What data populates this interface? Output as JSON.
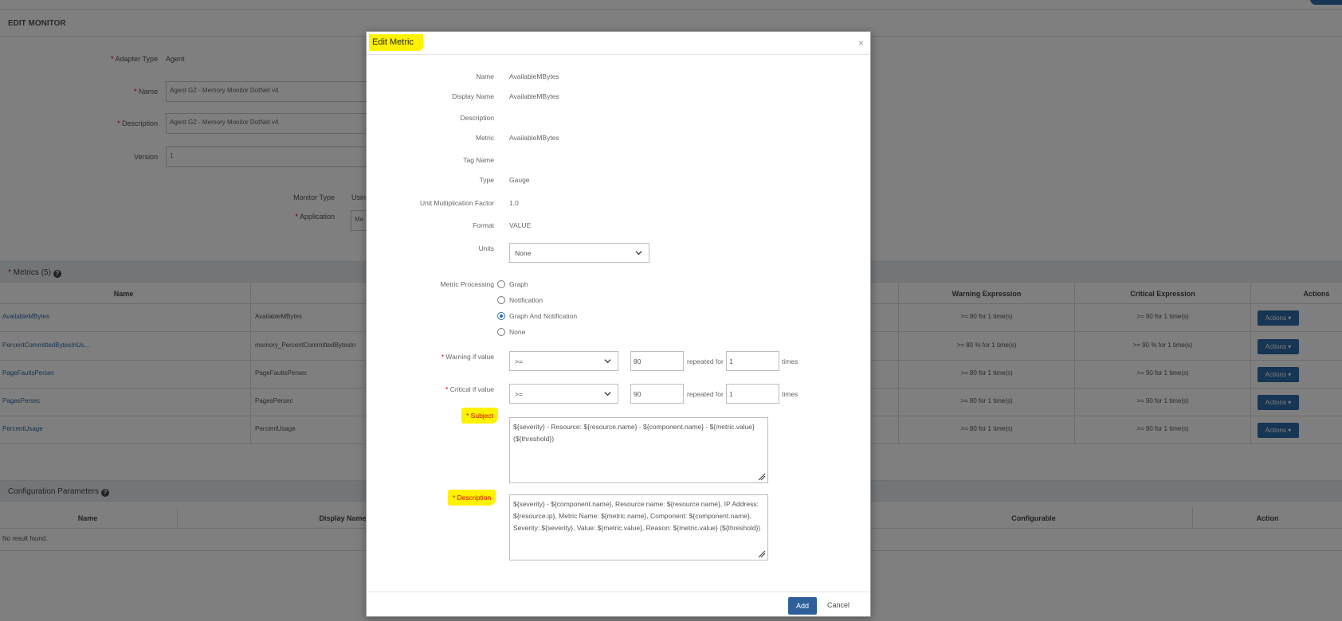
{
  "page": {
    "title": "EDIT MONITOR",
    "form": {
      "adapter_type_label": "Adapter Type",
      "adapter_type_value": "Agent",
      "name_label": "Name",
      "name_value": "Agent G2 - Memory Monitor DotNet v4",
      "description_label": "Description",
      "description_value": "Agent G2 - Memory Monitor DotNet v4",
      "version_label": "Version",
      "version_value": "1",
      "monitor_type_label": "Monitor Type",
      "monitor_type_value": "Usin",
      "application_label": "Application",
      "application_value": "Me"
    },
    "metrics": {
      "title": "Metrics (5)",
      "columns": [
        "Name",
        "Warning Expression",
        "Critical Expression",
        "Actions"
      ],
      "rows": [
        {
          "name": "AvailableMBytes",
          "display": "AvailableMBytes",
          "warning": ">= 80 for 1 time(s)",
          "critical": ">= 90 for 1 time(s)"
        },
        {
          "name": "PercentCommittedBytesInUs...",
          "display": "memory_PercentCommittedBytesIn",
          "warning": ">= 80 % for 1 time(s)",
          "critical": ">= 90 % for 1 time(s)"
        },
        {
          "name": "PageFaultsPersec",
          "display": "PageFaultsPersec",
          "warning": ">= 80 for 1 time(s)",
          "critical": ">= 90 for 1 time(s)"
        },
        {
          "name": "PagesPersec",
          "display": "PagesPersec",
          "warning": ">= 80 for 1 time(s)",
          "critical": ">= 90 for 1 time(s)"
        },
        {
          "name": "PercentUsage",
          "display": "PercentUsage",
          "warning": ">= 80 for 1 time(s)",
          "critical": ">= 90 for 1 time(s)"
        }
      ],
      "actions_label": "Actions"
    },
    "config": {
      "title": "Configuration Parameters",
      "columns": [
        "Name",
        "Display Name",
        "Configurable",
        "Action"
      ],
      "empty": "No result found."
    }
  },
  "modal": {
    "title": "Edit Metric",
    "close": "×",
    "fields": {
      "name_label": "Name",
      "name_value": "AvailableMBytes",
      "display_name_label": "Display Name",
      "display_name_value": "AvailableMBytes",
      "description_label": "Description",
      "description_value": "",
      "metric_label": "Metric",
      "metric_value": "AvailableMBytes",
      "tag_name_label": "Tag Name",
      "tag_name_value": "",
      "type_label": "Type",
      "type_value": "Gauge",
      "unit_mult_label": "Unit Multiplication Factor",
      "unit_mult_value": "1.0",
      "format_label": "Format",
      "format_value": "VALUE",
      "units_label": "Units",
      "units_value": "None"
    },
    "processing": {
      "label": "Metric Processing",
      "options": [
        "Graph",
        "Notification",
        "Graph And Notification",
        "None"
      ],
      "selected": "Graph And Notification"
    },
    "warning": {
      "label": "Warning if value",
      "operator": ">=",
      "value": "80",
      "repeated_label": "repeated for",
      "times_value": "1",
      "times_label": "times"
    },
    "critical": {
      "label": "Critical if value",
      "operator": ">=",
      "value": "90",
      "repeated_label": "repeated for",
      "times_value": "1",
      "times_label": "times"
    },
    "subject": {
      "label": "Subject",
      "value": "${severity} - Resource: ${resource.name} - ${component.name} - ${metric.value} (${threshold})"
    },
    "description": {
      "label": "Description",
      "value": "${severity} - ${component.name}, Resource name: ${resource.name}, IP Address: ${resource.ip}, Metric Name: ${metric.name}, Component: ${component.name}, Severity: ${severity}, Value: ${metric.value}, Reason: ${metric.value} (${threshold})"
    },
    "buttons": {
      "add": "Add",
      "cancel": "Cancel"
    }
  },
  "colors": {
    "accent": "#2e6aa8",
    "highlight": "#fff200",
    "required": "#cc0000",
    "overlay": "rgba(0,0,0,0.5)"
  }
}
